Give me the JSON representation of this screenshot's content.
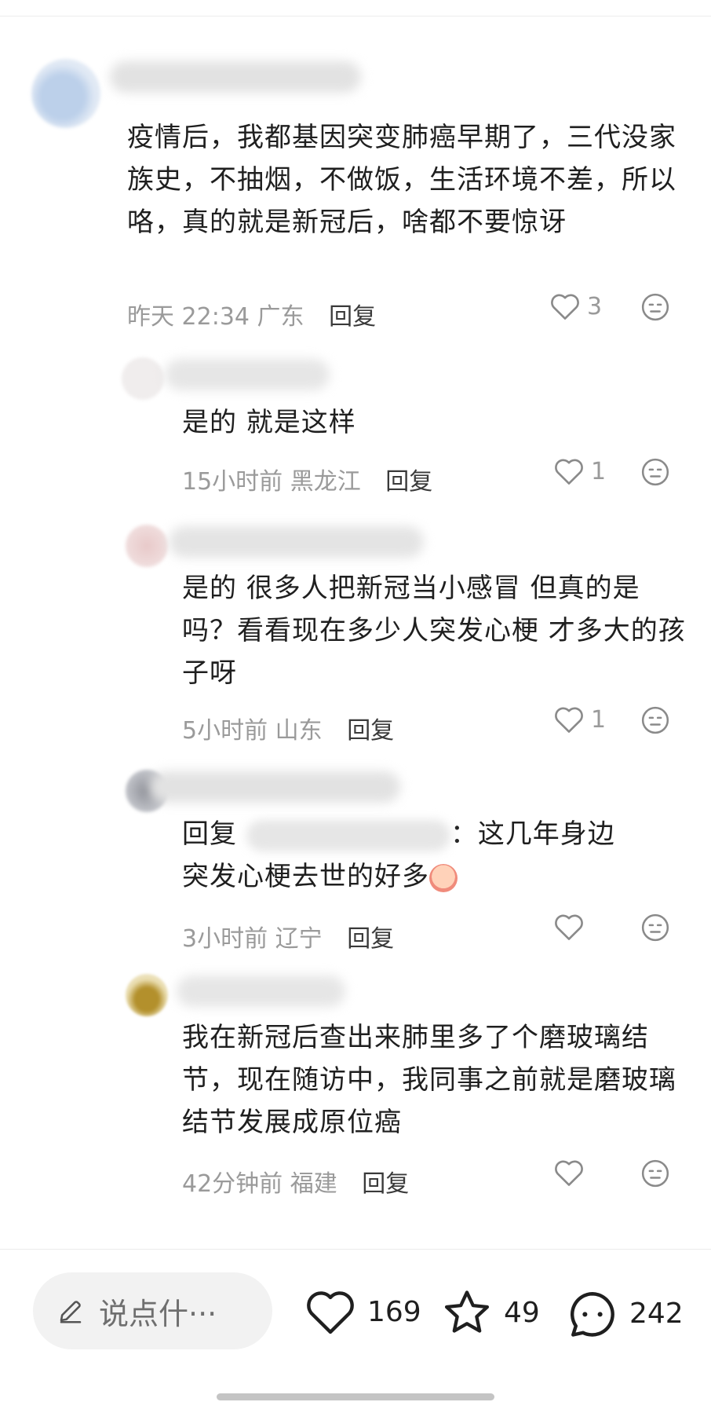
{
  "comments": [
    {
      "text": "疫情后，我都基因突变肺癌早期了，三代没家族史，不抽烟，不做饭，生活环境不差，所以咯，真的就是新冠后，啥都不要惊讶",
      "time": "昨天 22:34",
      "location": "广东",
      "reply_label": "回复",
      "likes": "3"
    },
    {
      "text": "是的 就是这样",
      "time": "15小时前",
      "location": "黑龙江",
      "reply_label": "回复",
      "likes": "1"
    },
    {
      "text": "是的 很多人把新冠当小感冒 但真的是吗？看看现在多少人突发心梗 才多大的孩子呀",
      "time": "5小时前",
      "location": "山东",
      "reply_label": "回复",
      "likes": "1"
    },
    {
      "reply_prefix": "回复",
      "reply_colon": "：",
      "text_line1": "这几年身边",
      "text_line2": "突发心梗去世的好多",
      "time": "3小时前",
      "location": "辽宁",
      "reply_label": "回复",
      "likes": ""
    },
    {
      "text": "我在新冠后查出来肺里多了个磨玻璃结节，现在随访中，我同事之前就是磨玻璃结节发展成原位癌",
      "time": "42分钟前",
      "location": "福建",
      "reply_label": "回复",
      "likes": ""
    }
  ],
  "bottom_bar": {
    "input_placeholder": "说点什···",
    "like_count": "169",
    "favorite_count": "49",
    "comment_count": "242"
  },
  "icons": {
    "like": "heart-outline-icon",
    "dislike": "neutral-face-icon",
    "favorite": "star-outline-icon",
    "comment": "chat-bubble-icon",
    "edit": "pencil-icon"
  }
}
